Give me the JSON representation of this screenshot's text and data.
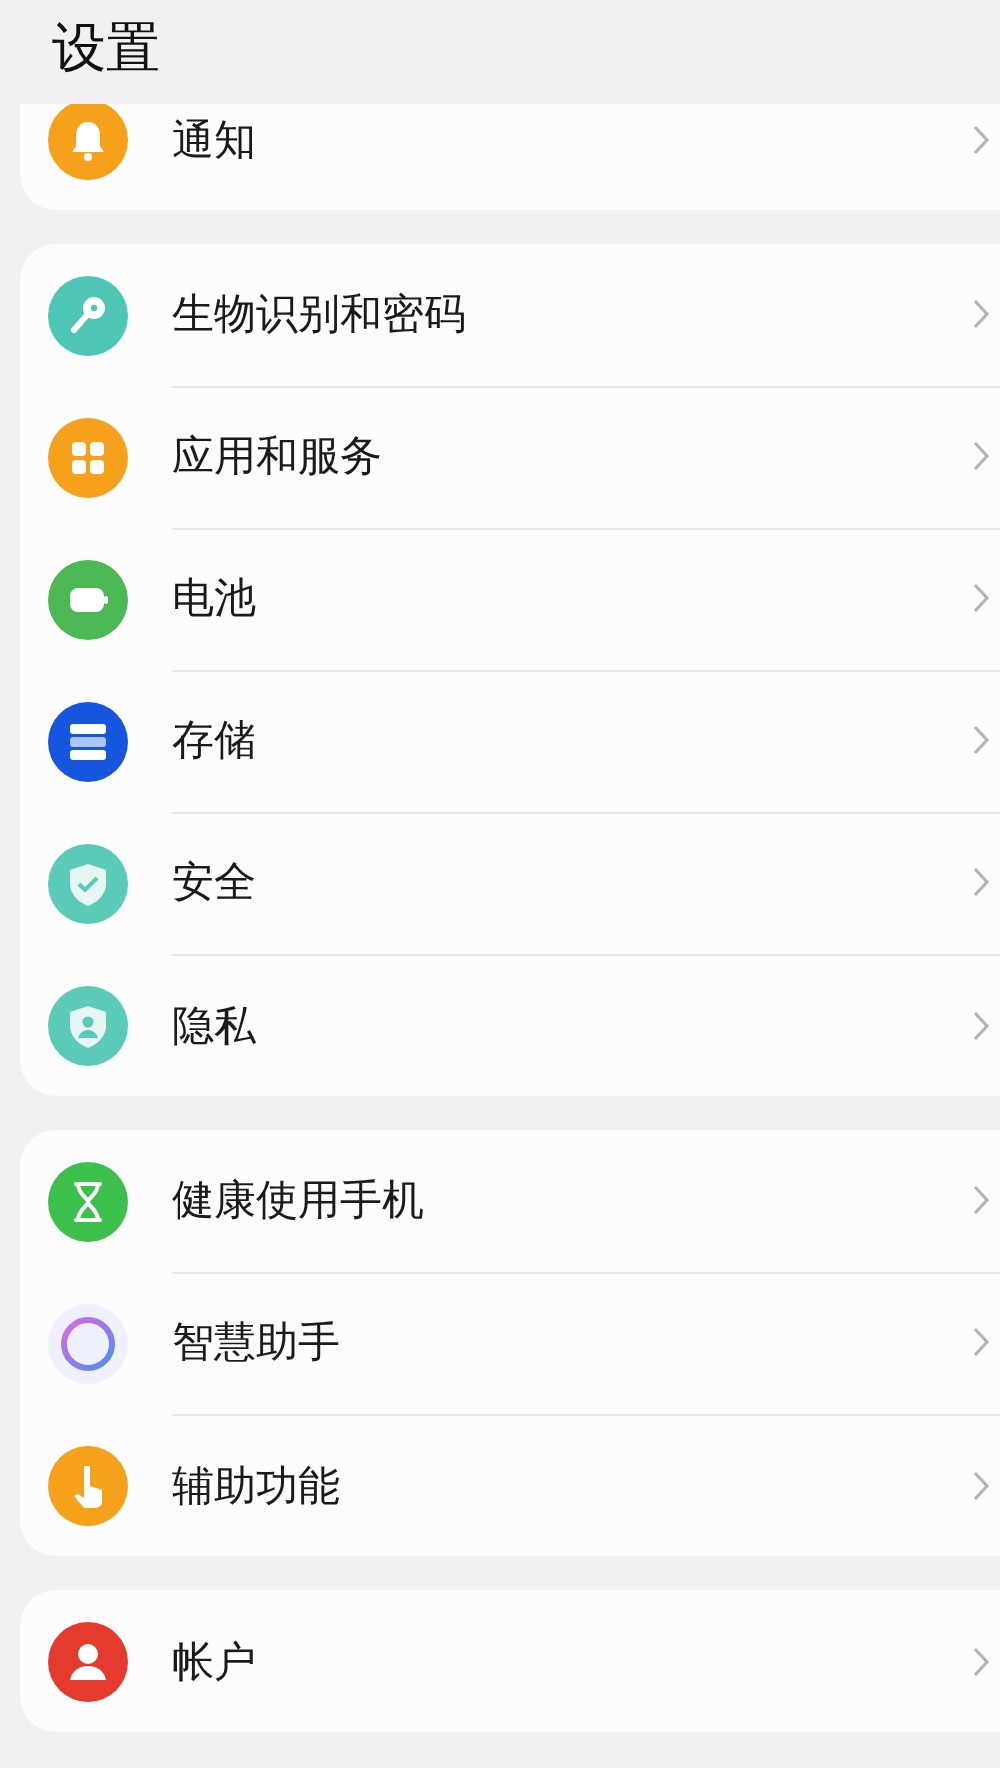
{
  "title": "设置",
  "groups": [
    {
      "items": [
        {
          "kind": "bell",
          "label": "通知"
        }
      ]
    },
    {
      "items": [
        {
          "kind": "key",
          "label": "生物识别和密码"
        },
        {
          "kind": "apps",
          "label": "应用和服务"
        },
        {
          "kind": "battery",
          "label": "电池"
        },
        {
          "kind": "storage",
          "label": "存储"
        },
        {
          "kind": "security",
          "label": "安全"
        },
        {
          "kind": "privacy",
          "label": "隐私"
        }
      ]
    },
    {
      "items": [
        {
          "kind": "hourglass",
          "label": "健康使用手机"
        },
        {
          "kind": "assistant",
          "label": "智慧助手"
        },
        {
          "kind": "hand",
          "label": "辅助功能"
        }
      ]
    },
    {
      "items": [
        {
          "kind": "account",
          "label": "帐户"
        }
      ]
    }
  ]
}
